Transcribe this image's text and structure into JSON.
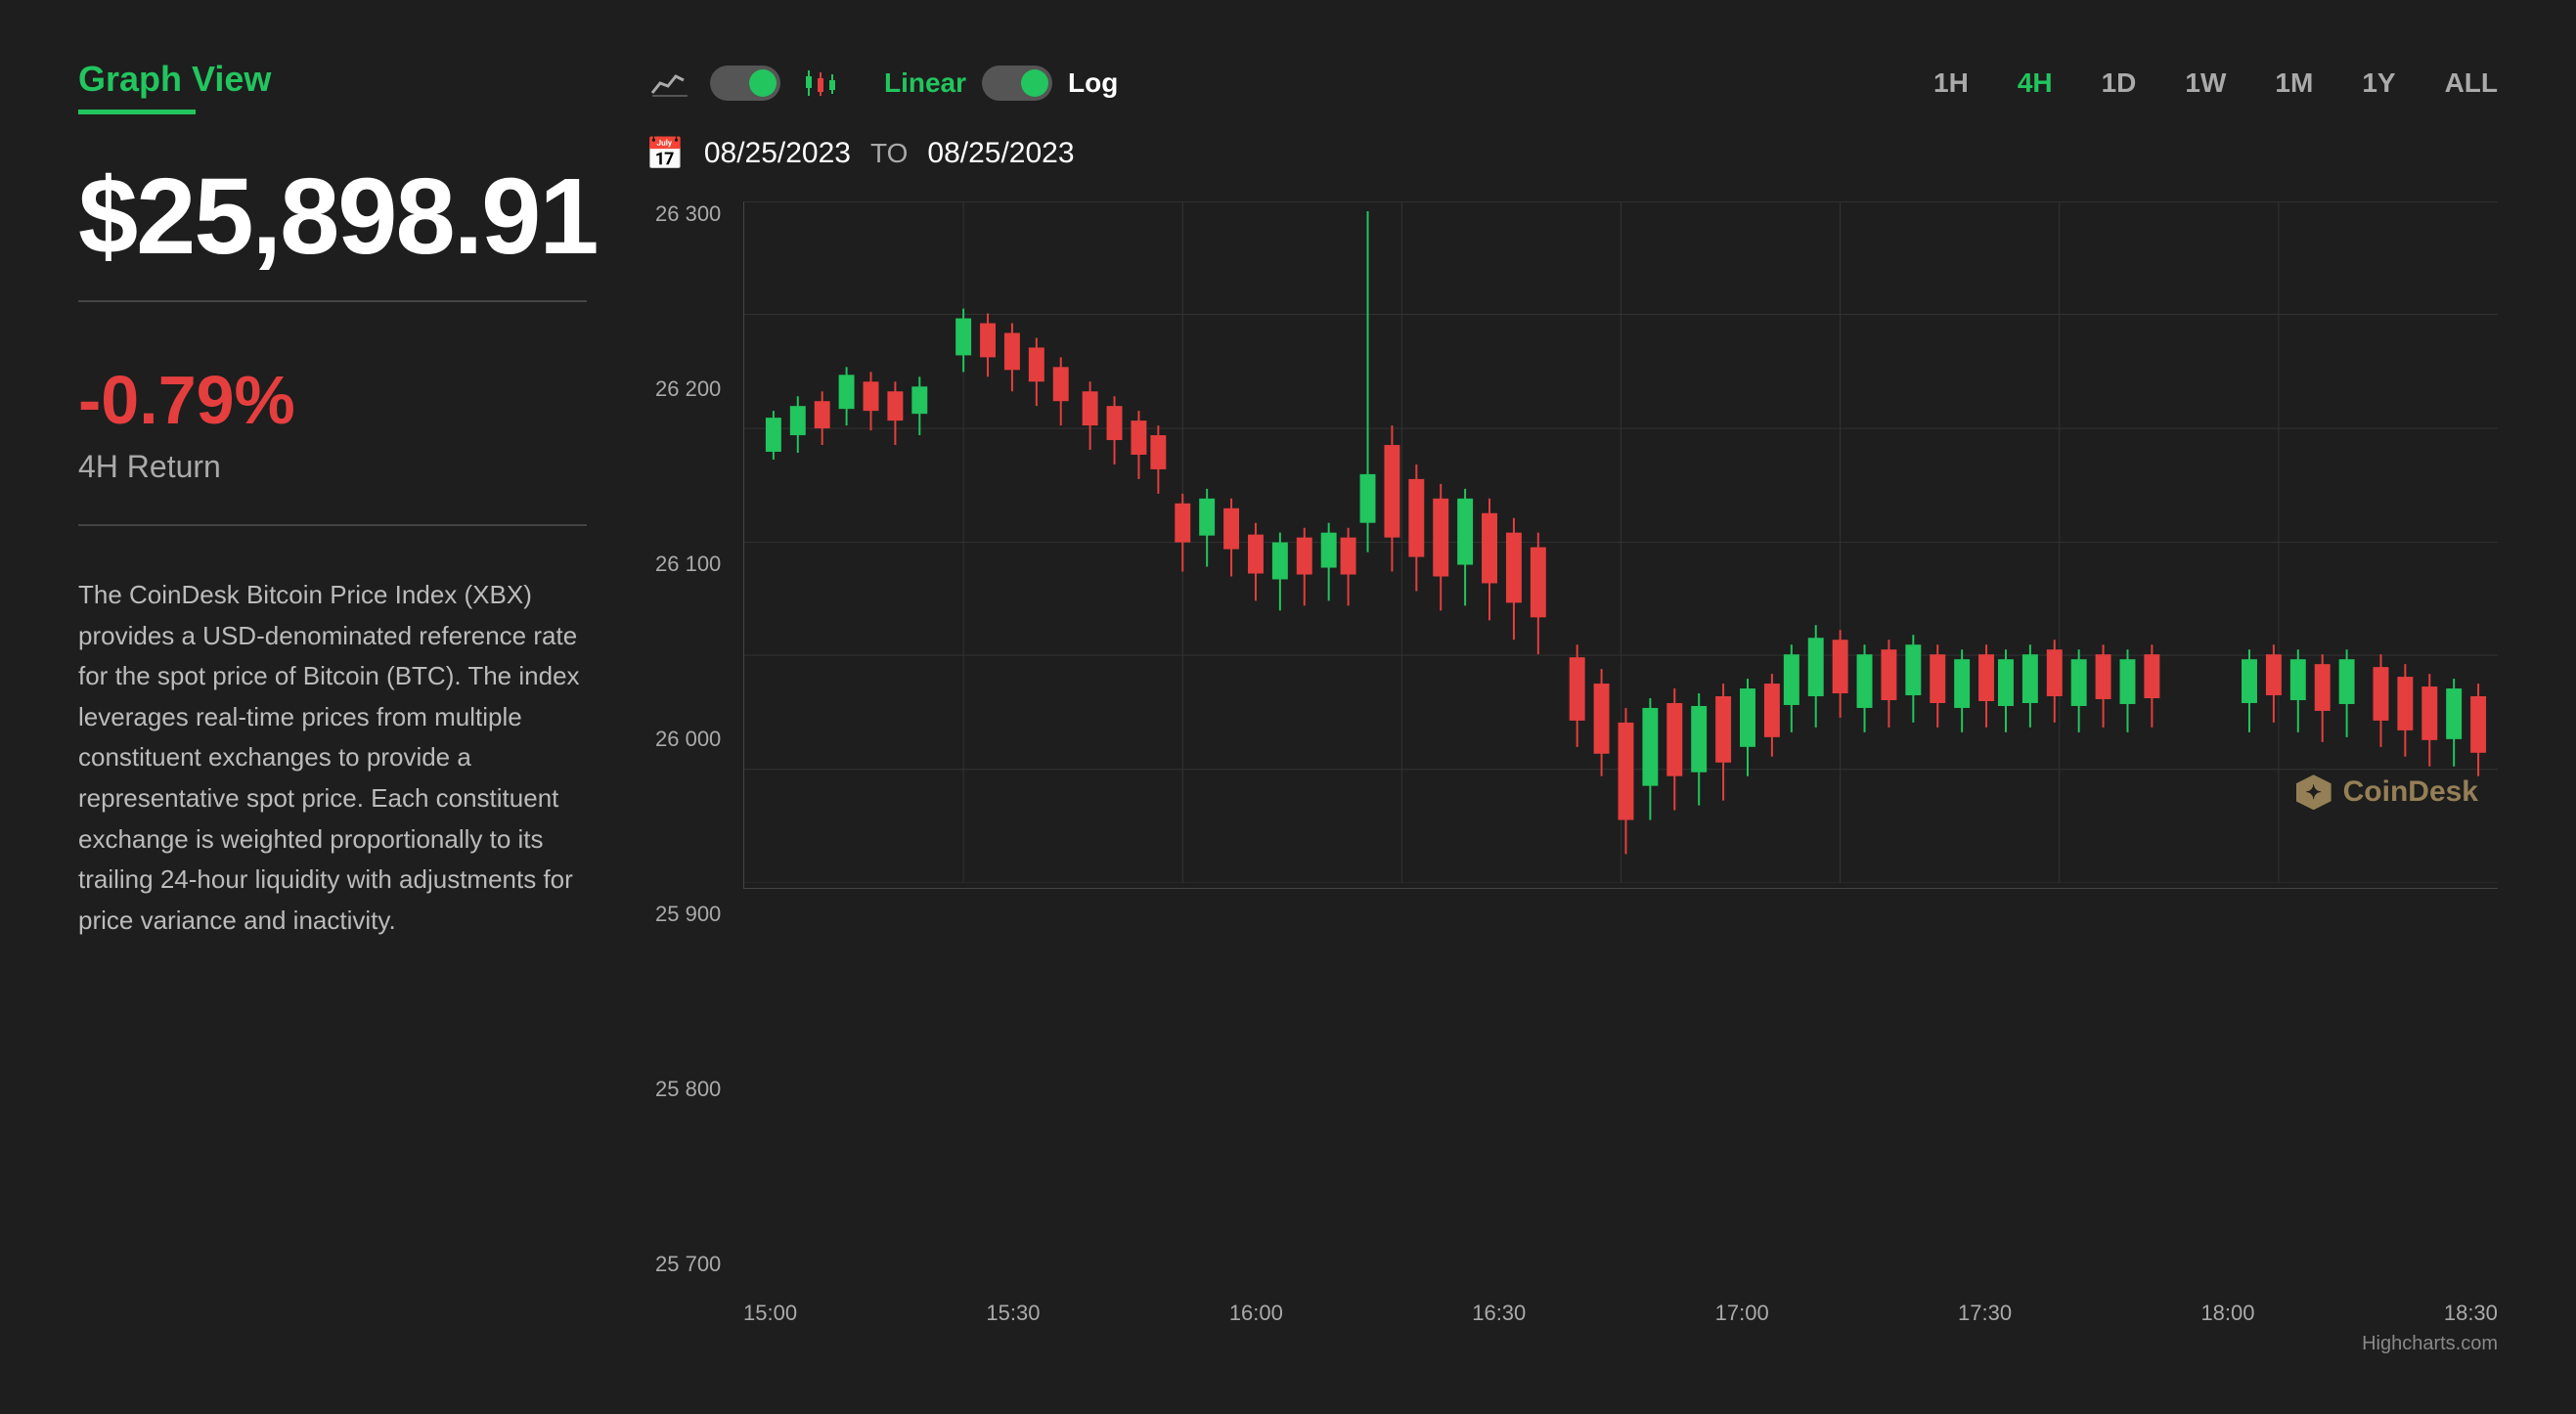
{
  "left": {
    "graph_view_label": "Graph View",
    "price": "$25,898.91",
    "price_change": "-0.79%",
    "return_label": "4H Return",
    "description": "The CoinDesk Bitcoin Price Index (XBX) provides a USD-denominated reference rate for the spot price of Bitcoin (BTC). The index leverages real-time prices from multiple constituent exchanges to provide a representative spot price. Each constituent exchange is weighted proportionally to its trailing 24-hour liquidity with adjustments for price variance and inactivity."
  },
  "controls": {
    "linear_label": "Linear",
    "log_label": "Log",
    "timeframes": [
      "1H",
      "4H",
      "1D",
      "1W",
      "1M",
      "1Y",
      "ALL"
    ],
    "active_timeframe": "4H",
    "date_from": "08/25/2023",
    "date_to_label": "TO",
    "date_to": "08/25/2023"
  },
  "chart": {
    "y_labels": [
      "26 300",
      "26 200",
      "26 100",
      "26 000",
      "25 900",
      "25 800",
      "25 700"
    ],
    "x_labels": [
      "15:00",
      "15:30",
      "16:00",
      "16:30",
      "17:00",
      "17:30",
      "18:00",
      "18:30"
    ],
    "highcharts_label": "Highcharts.com",
    "coindesk_label": "CoinDesk"
  }
}
